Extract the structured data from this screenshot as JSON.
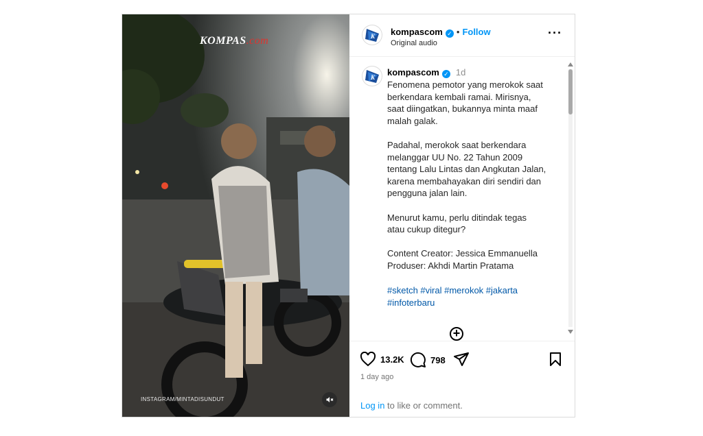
{
  "post": {
    "username": "kompascom",
    "follow_label": "Follow",
    "audio": "Original audio",
    "time_short": "1d",
    "caption_lines": "Fenomena pemotor yang merokok saat\nberkendara kembali ramai. Mirisnya,\nsaat diingatkan, bukannya minta maaf\nmalah galak.\n\nPadahal, merokok saat berkendara\nmelanggar UU No. 22 Tahun 2009\ntentang Lalu Lintas dan Angkutan Jalan,\nkarena membahayakan diri sendiri dan\npengguna jalan lain.\n\nMenurut kamu, perlu ditindak tegas\natau cukup ditegur?\n\nContent Creator: Jessica Emmanuella\nProduser: Akhdi Martin Pratama\n",
    "hashtags_line1": "#sketch #viral #merokok #jakarta",
    "hashtags_line2": "#infoterbaru",
    "likes": "13.2K",
    "comments": "798",
    "posted_ago": "1 day ago",
    "login_link": "Log in",
    "login_rest": " to like or comment."
  },
  "video": {
    "watermark_main": "KOMPAS",
    "watermark_suffix": ".com",
    "source_credit": "INSTAGRAM/MINTADISUNDUT"
  },
  "colors": {
    "accent": "#0095f6",
    "hashtag": "#0058a8",
    "brand_red": "#e0332e",
    "brand_blue": "#1b4f9c"
  },
  "icons": {
    "more": "more-options-icon",
    "verified": "verified-badge-icon",
    "like": "heart-icon",
    "comment": "comment-icon",
    "share": "share-icon",
    "save": "bookmark-icon",
    "mute": "muted-speaker-icon",
    "add": "plus-circle-icon"
  }
}
